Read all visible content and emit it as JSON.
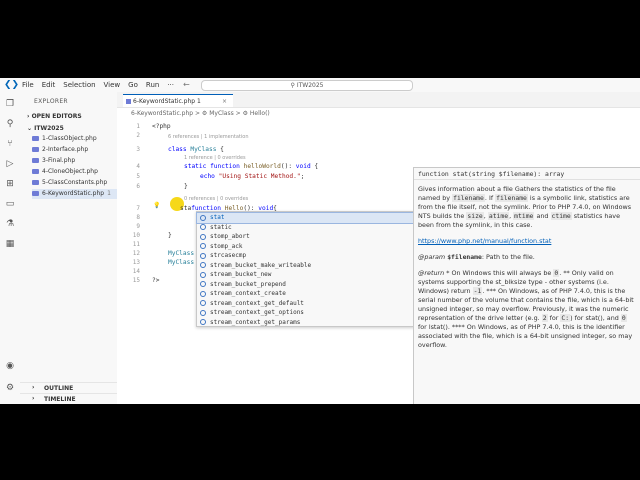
{
  "titlebar": {
    "menu": [
      "File",
      "Edit",
      "Selection",
      "View",
      "Go",
      "Run"
    ],
    "more": "···",
    "nav": "← →",
    "search": "ITW2025"
  },
  "sidebar": {
    "title": "EXPLORER",
    "open_editors": "OPEN EDITORS",
    "folder": "ITW2025",
    "files": [
      {
        "name": "1-ClassObject.php",
        "badge": ""
      },
      {
        "name": "2-Interface.php",
        "badge": ""
      },
      {
        "name": "3-Final.php",
        "badge": ""
      },
      {
        "name": "4-CloneObject.php",
        "badge": ""
      },
      {
        "name": "5-ClassConstants.php",
        "badge": ""
      },
      {
        "name": "6-KeywordStatic.php",
        "badge": "1"
      }
    ],
    "outline": "OUTLINE",
    "timeline": "TIMELINE"
  },
  "editor": {
    "tab": {
      "name": "6-KeywordStatic.php",
      "badge": "1"
    },
    "breadcrumb": "6-KeywordStatic.php > ⚙ MyClass > ⚙ Hello()",
    "lens1": "6 references | 1 implementation",
    "lens2": "1 reference | 0 overrides",
    "lens3": "0 references | 0 overrides",
    "lines": {
      "l1": "<?php",
      "l3_kw": "class ",
      "l3_cls": "MyClass",
      "l3_rest": " {",
      "l4_kw": "static function ",
      "l4_fn": "helloWorld",
      "l4_rest": "(): ",
      "l4_ty": "void",
      "l4_end": " {",
      "l5_kw": "echo ",
      "l5_str": "\"Using Static Method.\"",
      "l5_end": ";",
      "l6": "}",
      "l7_a": "sta",
      "l7_kw": "function ",
      "l7_fn": "Hello",
      "l7_rest": "(): ",
      "l7_ty": "void",
      "l7_end": "{",
      "l10": "}",
      "l12": "MyClass",
      "l13": "MyClass",
      "l15": "?>"
    },
    "line_numbers": [
      "1",
      "2",
      "3",
      "4",
      "5",
      "6",
      "7",
      "8",
      "9",
      "10",
      "11",
      "12",
      "13",
      "14",
      "15"
    ]
  },
  "suggestions": [
    "stat",
    "static",
    "stomp_abort",
    "stomp_ack",
    "strcasecmp",
    "stream_bucket_make_writeable",
    "stream_bucket_new",
    "stream_bucket_prepend",
    "stream_context_create",
    "stream_context_get_default",
    "stream_context_get_options",
    "stream_context_get_params"
  ],
  "doc": {
    "signature": "function stat(string $filename): array",
    "p1a": "Gives information about a file Gathers the statistics of the file named by ",
    "p1_code1": "filename",
    "p1b": ". If ",
    "p1_code2": "filename",
    "p1c": " is a symbolic link, statistics are from the file itself, not the symlink. Prior to PHP 7.4.0, on Windows NTS builds the ",
    "p1_code3": "size",
    "p1d": ", ",
    "p1_code4": "atime",
    "p1e": ", ",
    "p1_code5": "mtime",
    "p1f": " and ",
    "p1_code6": "ctime",
    "p1g": " statistics have been from the symlink, in this case.",
    "link": "https://www.php.net/manual/function.stat",
    "param_tag": "@param",
    "param_name": "$filename",
    "param_desc": ": Path to the file.",
    "return_tag": "@return",
    "return_a": " * On Windows this will always be ",
    "return_code1": "0",
    "return_b": ". ** Only valid on systems supporting the st_blksize type - other systems (i.e. Windows) return ",
    "return_code2": "-1",
    "return_c": ". *** On Windows, as of PHP 7.4.0, this is the serial number of the volume that contains the file, which is a 64-bit unsigned integer, so may overflow. Previously, it was the numeric representation of the drive letter (e.g. ",
    "return_code3": "2",
    "return_d": " for ",
    "return_code4": "C:",
    "return_e": ") for stat(), and ",
    "return_code5": "0",
    "return_f": " for lstat(). **** On Windows, as of PHP 7.4.0, this is the identifier associated with the file, which is a 64-bit unsigned integer, so may overflow."
  },
  "colors": {
    "accent": "#005fb8",
    "keyword": "#0000ff",
    "function": "#795e26",
    "class": "#267f99",
    "string": "#a31515"
  }
}
